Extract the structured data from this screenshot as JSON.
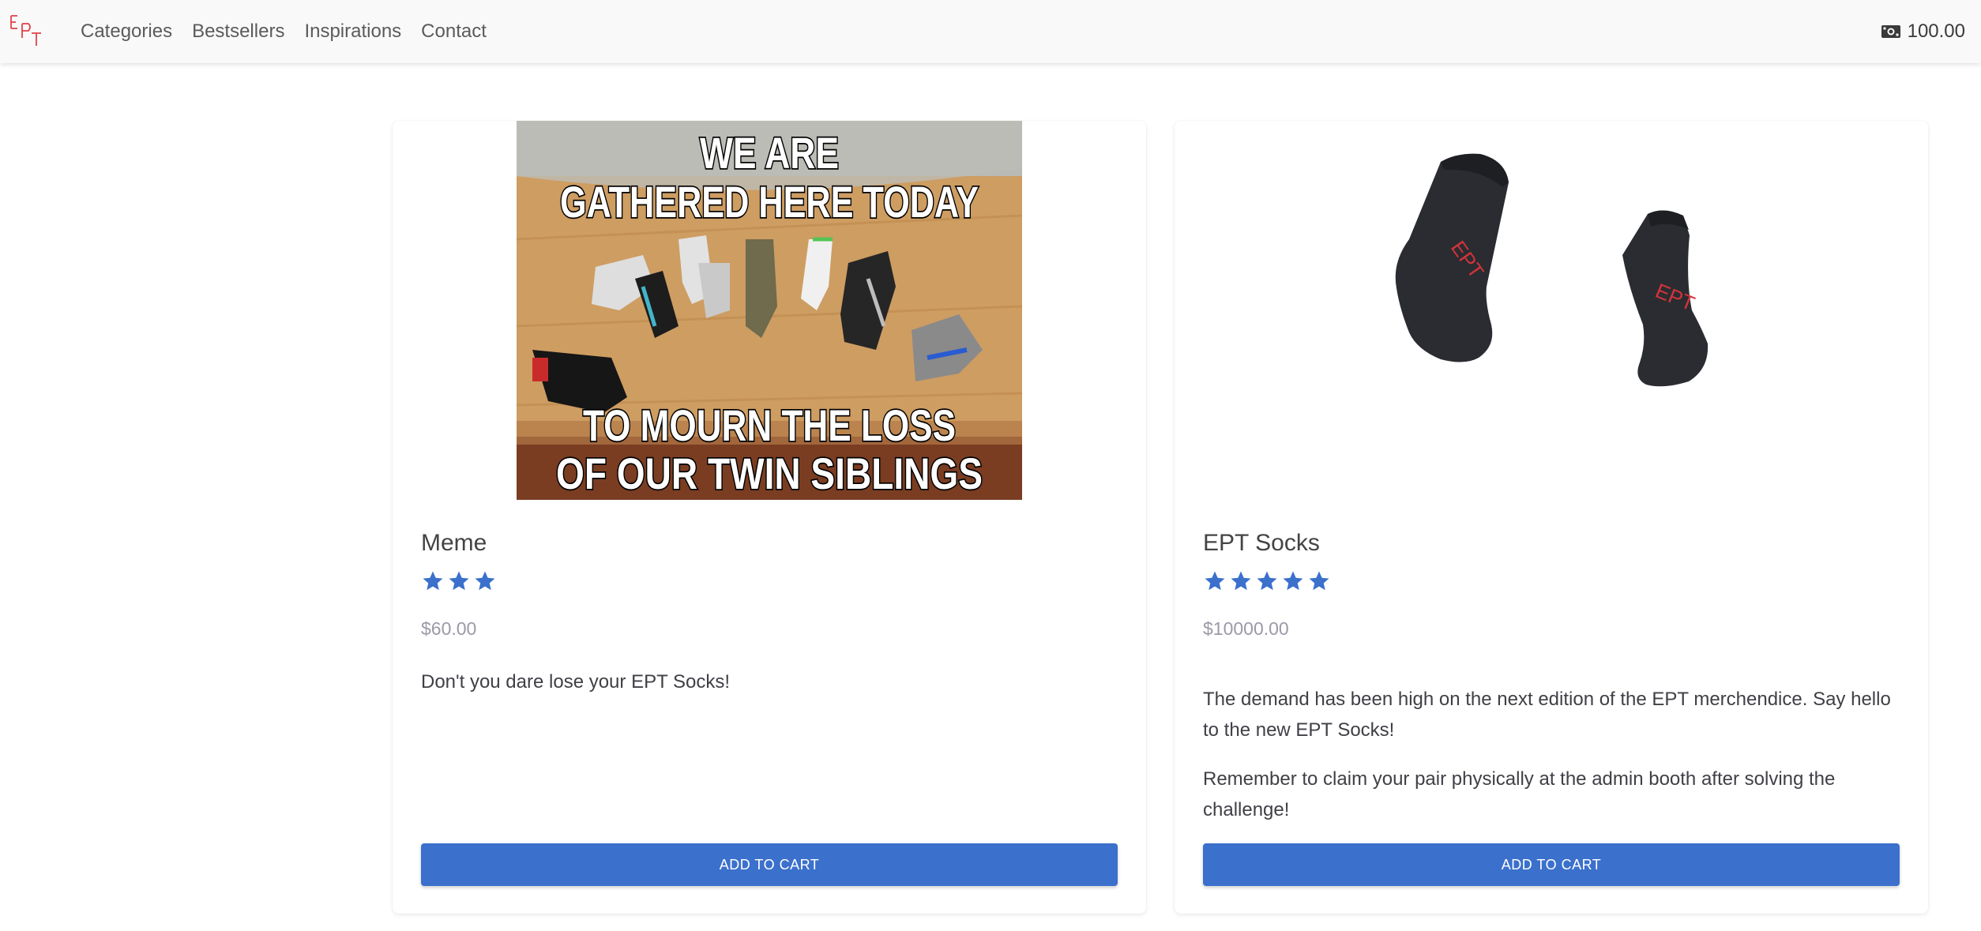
{
  "brand": {
    "logo_text": "EPT",
    "logo_color": "#e0424b"
  },
  "nav": {
    "items": [
      {
        "label": "Categories"
      },
      {
        "label": "Bestsellers"
      },
      {
        "label": "Inspirations"
      },
      {
        "label": "Contact"
      }
    ]
  },
  "wallet": {
    "icon": "money-bill-icon",
    "balance": "100.00"
  },
  "products": [
    {
      "title": "Meme",
      "rating": 3,
      "price": "$60.00",
      "image": {
        "kind": "meme",
        "top_text_line1": "WE ARE",
        "top_text_line2": "GATHERED HERE TODAY",
        "bottom_text_line1": "TO MOURN THE LOSS",
        "bottom_text_line2": "OF OUR TWIN SIBLINGS"
      },
      "description": [
        "Don't you dare lose your EPT Socks!"
      ],
      "button_label": "ADD TO CART"
    },
    {
      "title": "EPT Socks",
      "rating": 5,
      "price": "$10000.00",
      "image": {
        "kind": "socks",
        "sock_text": "EPT"
      },
      "description": [
        "The demand has been high on the next edition of the EPT merchendice. Say hello to the new EPT Socks!",
        "Remember to claim your pair physically at the admin booth after solving the challenge!"
      ],
      "button_label": "ADD TO CART"
    }
  ],
  "colors": {
    "accent": "#3b70cc",
    "star": "#3b70cc",
    "price": "#9a9aa8",
    "navbar_bg": "#f9f9f9"
  }
}
